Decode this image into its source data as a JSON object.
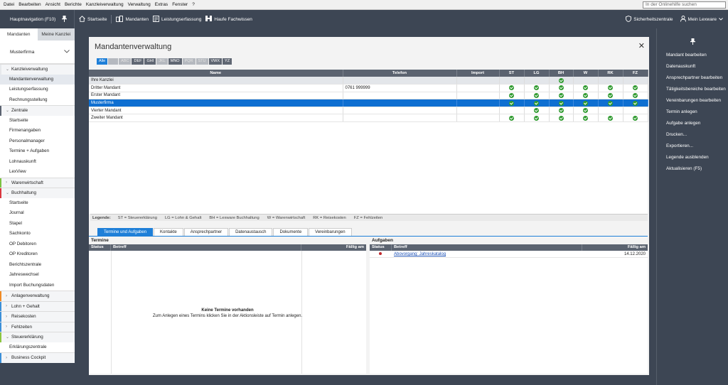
{
  "menu": [
    "Datei",
    "Bearbeiten",
    "Ansicht",
    "Berichte",
    "Kanzleiverwaltung",
    "Verwaltung",
    "Extras",
    "Fenster",
    "?"
  ],
  "search": {
    "placeholder": "In der Onlinehilfe suchen"
  },
  "toolbar": {
    "nav_title": "Hauptnavigation (F10)",
    "startseite": "Startseite",
    "mandanten": "Mandanten",
    "leistungserfassung": "Leistungserfassung",
    "haufe": "Haufe Fachwissen",
    "sicherheitszentrale": "Sicherheitszentrale",
    "account": "Mein Lexware"
  },
  "sidebar": {
    "tabs": [
      "Mandanten",
      "Meine Kanzlei"
    ],
    "client": "Musterfirma",
    "sections": [
      {
        "label": "Kanzleiverwaltung",
        "color": "#e7e9ec",
        "open": true,
        "items": [
          "Mandantenverwaltung",
          "Leistungserfassung",
          "Rechnungsstellung"
        ]
      },
      {
        "label": "Zentrale",
        "color": "#5b6370",
        "open": true,
        "items": [
          "Startseite",
          "Firmenangaben",
          "Personalmanager",
          "Termine + Aufgaben",
          "Lohnauskunft",
          "LexView"
        ]
      },
      {
        "label": "Warenwirtschaft",
        "color": "#7cc242",
        "open": false,
        "items": []
      },
      {
        "label": "Buchhaltung",
        "color": "#d9363e",
        "open": true,
        "items": [
          "Startseite",
          "Journal",
          "Stapel",
          "Sachkonto",
          "OP Debitoren",
          "OP Kreditoren",
          "Berichtszentrale",
          "Jahreswechsel",
          "Import Buchungsdaten"
        ]
      },
      {
        "label": "Anlagenverwaltung",
        "color": "#f08a24",
        "open": false,
        "items": []
      },
      {
        "label": "Lohn + Gehalt",
        "color": "#3b8fd9",
        "open": false,
        "items": []
      },
      {
        "label": "Reisekosten",
        "color": "#3b8fd9",
        "open": false,
        "items": []
      },
      {
        "label": "Fehlzeiten",
        "color": "#3b8fd9",
        "open": false,
        "items": []
      },
      {
        "label": "Steuererklärung",
        "color": "#8dc63f",
        "open": true,
        "items": [
          "Erklärungszentrale"
        ]
      },
      {
        "label": "Business Cockpit",
        "color": "#3b8fd9",
        "open": false,
        "items": []
      }
    ]
  },
  "main": {
    "title": "Mandantenverwaltung",
    "alpha_filters": [
      {
        "label": "Alle",
        "state": "active"
      },
      {
        "label": "",
        "state": "dim"
      },
      {
        "label": "ABC",
        "state": "dim"
      },
      {
        "label": "DEF",
        "state": "on"
      },
      {
        "label": "GHI",
        "state": "on"
      },
      {
        "label": "JKL",
        "state": "dim"
      },
      {
        "label": "MNO",
        "state": "on"
      },
      {
        "label": "PQR",
        "state": "dim"
      },
      {
        "label": "STU",
        "state": "dim"
      },
      {
        "label": "VWX",
        "state": "on"
      },
      {
        "label": "YZ",
        "state": "on"
      }
    ],
    "columns": [
      "Name",
      "Telefon",
      "Import",
      "ST",
      "LG",
      "BH",
      "W",
      "RK",
      "FZ"
    ],
    "rows": [
      {
        "name": "Ihre Kanzlei",
        "phone": "",
        "import": "",
        "checks": [
          false,
          false,
          true,
          false,
          false,
          false
        ],
        "group": true,
        "selected": false
      },
      {
        "name": "Dritter Mandant",
        "phone": "0761 999999",
        "import": "",
        "checks": [
          true,
          true,
          true,
          true,
          true,
          true
        ],
        "group": false,
        "selected": false
      },
      {
        "name": "Erster Mandant",
        "phone": "",
        "import": "",
        "checks": [
          true,
          true,
          true,
          true,
          true,
          true
        ],
        "group": false,
        "selected": false
      },
      {
        "name": "Musterfirma",
        "phone": "",
        "import": "",
        "checks": [
          true,
          true,
          true,
          true,
          true,
          true
        ],
        "group": false,
        "selected": true
      },
      {
        "name": "Vierter Mandant",
        "phone": "",
        "import": "",
        "checks": [
          false,
          true,
          true,
          true,
          false,
          false
        ],
        "group": false,
        "selected": false
      },
      {
        "name": "Zweiter Mandant",
        "phone": "",
        "import": "",
        "checks": [
          true,
          true,
          true,
          true,
          true,
          true
        ],
        "group": false,
        "selected": false
      }
    ],
    "legend_title": "Legende:",
    "legend": [
      "ST = Steuererklärung",
      "LG = Lohn & Gehalt",
      "BH = Lexware Buchhaltung",
      "W = Warenwirtschaft",
      "RK = Reisekosten",
      "FZ = Fehlzeiten"
    ],
    "tabs": [
      "Termine und Aufgaben",
      "Kontakte",
      "Ansprechpartner",
      "Datenaustausch",
      "Dokumente",
      "Vereinbarungen"
    ],
    "termine": {
      "title": "Termine",
      "columns": [
        "Status",
        "Betreff",
        "Fällig am"
      ],
      "empty_title": "Keine Termine vorhanden",
      "empty_text": "Zum Anlegen eines Termins klicken Sie in der Aktionsleiste auf Termin anlegen."
    },
    "aufgaben": {
      "title": "Aufgaben",
      "columns": [
        "Status",
        "Betreff",
        "Fällig am"
      ],
      "rows": [
        {
          "subject": "Abovorgang: Jahreskatalog",
          "due": "14.12.2020"
        }
      ]
    }
  },
  "actions": [
    "Mandant bearbeiten",
    "Datenauskunft",
    "Ansprechpartner bearbeiten",
    "Tätigkeitsbereiche bearbeiten",
    "Vereinbarungen bearbeiten",
    "Termin anlegen",
    "Aufgabe anlegen",
    "Drucken...",
    "Exportieren...",
    "Legende ausblenden",
    "Aktualisieren (F5)"
  ],
  "colors": {
    "accent": "#1e7fd8",
    "chrome": "#3d4654",
    "check": "#2f9a2f"
  }
}
